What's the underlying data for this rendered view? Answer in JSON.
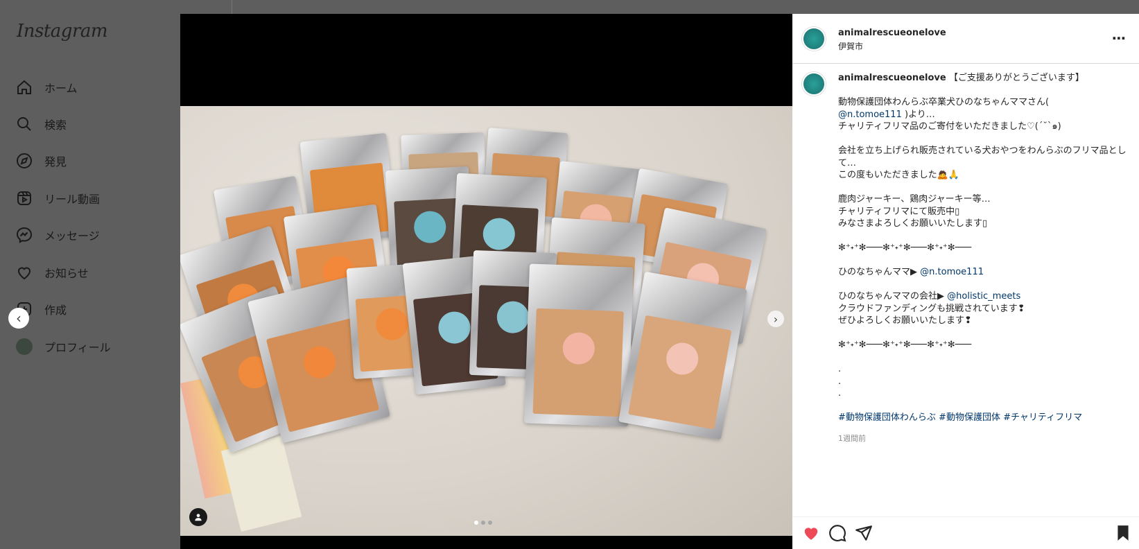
{
  "sidebar": {
    "logo": "Instagram",
    "items": [
      {
        "label": "ホーム"
      },
      {
        "label": "検索"
      },
      {
        "label": "発見"
      },
      {
        "label": "リール動画"
      },
      {
        "label": "メッセージ"
      },
      {
        "label": "お知らせ"
      },
      {
        "label": "作成"
      },
      {
        "label": "プロフィール"
      }
    ]
  },
  "post": {
    "username": "animalrescueonelove",
    "location": "伊賀市",
    "caption_title": " 【ご支援ありがとうございます】",
    "lines": [
      "動物保護団体わんらぶ卒業犬ひのなちゃんママさん(",
      "@n.tomoe111",
      " )より…",
      "チャリティフリマ品のご寄付をいただきました♡(´˘`๑)",
      "会社を立ち上げられ販売されている犬おやつをわんらぶのフリマ品として…",
      "この度もいただきました🙇🙏",
      "鹿肉ジャーキー、鶏肉ジャーキー等…",
      "チャリティフリマにて販売中▯",
      "みなさまよろしくお願いいたします▯",
      "✻⁺˖⁺✻───✻⁺˖⁺✻───✻⁺˖⁺✻───",
      "ひのなちゃんママ▶ ",
      "@n.tomoe111",
      "ひのなちゃんママの会社▶ ",
      "@holistic_meets",
      "クラウドファンディングも挑戦されています❢",
      "ぜひよろしくお願いいたします❢",
      "✻⁺˖⁺✻───✻⁺˖⁺✻───✻⁺˖⁺✻───",
      ".",
      ".",
      ".",
      "#動物保護団体わんらぶ",
      "#動物保護団体",
      "#チャリティフリマ"
    ],
    "time": "1週間前"
  }
}
